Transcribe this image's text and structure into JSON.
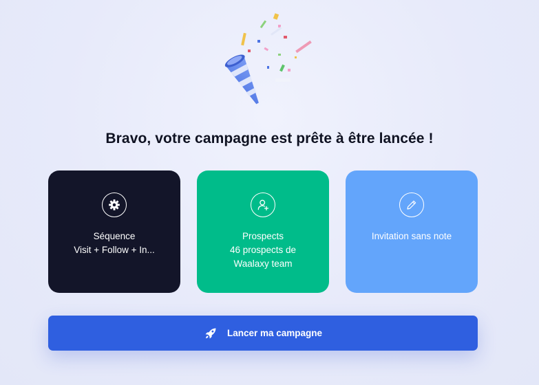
{
  "title": "Bravo, votre campagne est prête à être lancée !",
  "cards": {
    "sequence": {
      "label": "Séquence",
      "value": "Visit + Follow + In...",
      "icon": "gear-icon",
      "color": "#131529"
    },
    "prospects": {
      "label": "Prospects",
      "value": "46 prospects de Waalaxy team",
      "icon": "user-add-icon",
      "color": "#00bc8a"
    },
    "invitation": {
      "label": "Invitation sans note",
      "icon": "pencil-icon",
      "color": "#63a5fb"
    }
  },
  "launch_button": {
    "label": "Lancer ma campagne",
    "icon": "rocket-icon",
    "color": "#2f5fe0"
  },
  "illustration": {
    "icon": "party-popper-icon"
  }
}
